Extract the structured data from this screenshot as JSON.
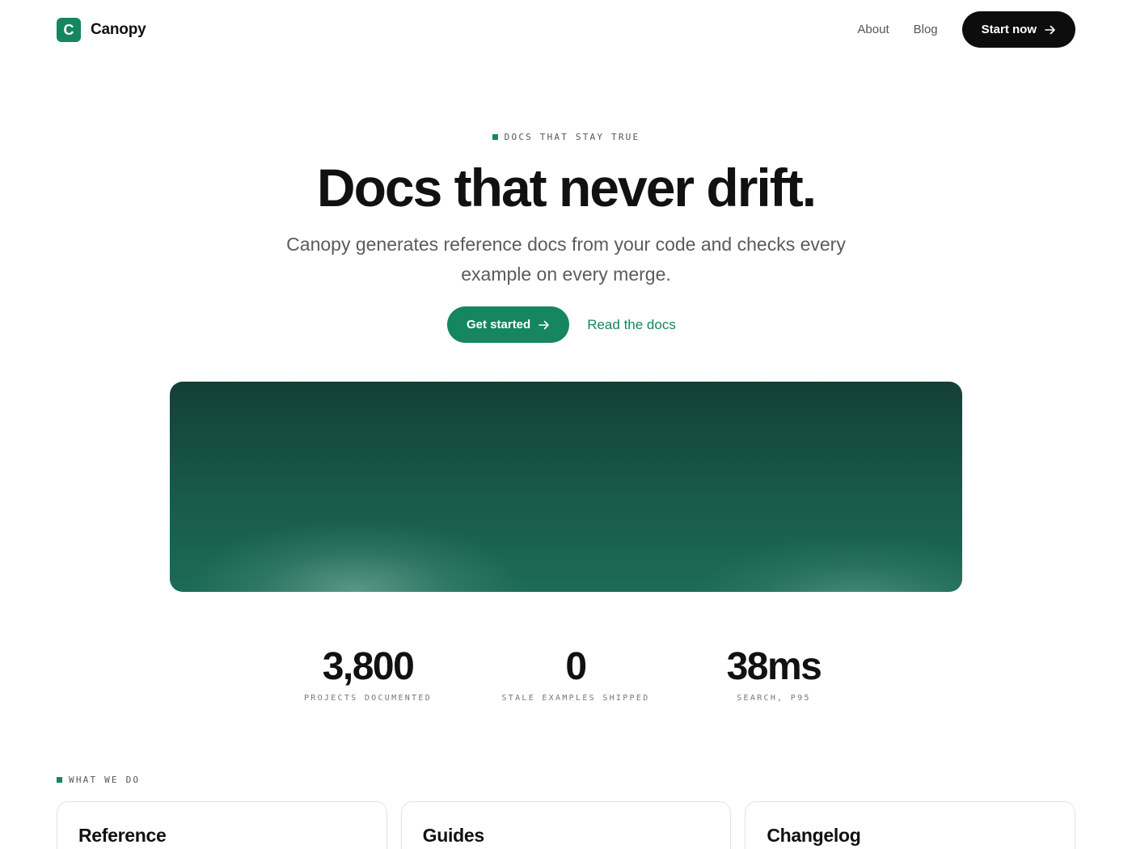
{
  "brand": {
    "logo_letter": "C",
    "name": "Canopy"
  },
  "nav": {
    "about": "About",
    "blog": "Blog",
    "start_now": "Start now"
  },
  "hero": {
    "eyebrow": "DOCS THAT STAY TRUE",
    "title": "Docs that never drift.",
    "subtitle": "Canopy generates reference docs from your code and checks every example on every merge.",
    "primary_cta": "Get started",
    "secondary_cta": "Read the docs"
  },
  "stats": [
    {
      "value": "3,800",
      "label": "PROJECTS DOCUMENTED"
    },
    {
      "value": "0",
      "label": "STALE EXAMPLES SHIPPED"
    },
    {
      "value": "38ms",
      "label": "SEARCH, P95"
    }
  ],
  "section": {
    "eyebrow": "WHAT WE DO",
    "cards": [
      {
        "title": "Reference"
      },
      {
        "title": "Guides"
      },
      {
        "title": "Changelog"
      }
    ]
  },
  "colors": {
    "accent": "#15865f",
    "dark_button": "#0d0d0d",
    "banner_top": "#133f38",
    "banner_bottom": "#1c6b58"
  },
  "icons": {
    "arrow": "arrow-right-icon"
  }
}
